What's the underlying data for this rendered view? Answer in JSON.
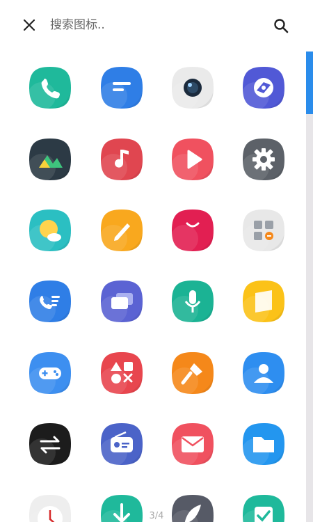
{
  "header": {
    "close_icon": "close-icon",
    "search_placeholder": "搜索图标..",
    "search_icon": "search-icon"
  },
  "icons": [
    {
      "name": "phone-icon",
      "color": "#1fb99b"
    },
    {
      "name": "messages-icon",
      "color": "#2f7ee6"
    },
    {
      "name": "camera-icon",
      "color": "#eaeaea"
    },
    {
      "name": "browser-icon",
      "color": "#5159d6"
    },
    {
      "name": "gallery-icon",
      "color": "#2c3a45"
    },
    {
      "name": "music-icon",
      "color": "#e04650"
    },
    {
      "name": "video-icon",
      "color": "#f0515f"
    },
    {
      "name": "settings-icon",
      "color": "#5c6168"
    },
    {
      "name": "weather-icon",
      "color": "#2bbfc2"
    },
    {
      "name": "notes-icon",
      "color": "#f9a81e"
    },
    {
      "name": "store-icon",
      "color": "#e21f52"
    },
    {
      "name": "tools-folder-icon",
      "color": "#e8e8e8"
    },
    {
      "name": "contacts-phone-icon",
      "color": "#2f7ee6"
    },
    {
      "name": "multitask-icon",
      "color": "#5b63d3"
    },
    {
      "name": "recorder-icon",
      "color": "#1bb394"
    },
    {
      "name": "files-yellow-icon",
      "color": "#fbc218"
    },
    {
      "name": "game-center-icon",
      "color": "#3d8ff0"
    },
    {
      "name": "theme-shapes-icon",
      "color": "#e8464e"
    },
    {
      "name": "paint-brush-icon",
      "color": "#f5881a"
    },
    {
      "name": "contacts-icon",
      "color": "#2e8ef0"
    },
    {
      "name": "data-transfer-icon",
      "color": "#1c1c1c"
    },
    {
      "name": "radio-icon",
      "color": "#4b63c8"
    },
    {
      "name": "email-icon",
      "color": "#f0515f"
    },
    {
      "name": "file-manager-icon",
      "color": "#2396ef"
    },
    {
      "name": "clock-icon",
      "color": "#eeeeee"
    },
    {
      "name": "download-icon",
      "color": "#1fb99b"
    },
    {
      "name": "feather-icon",
      "color": "#565a66"
    },
    {
      "name": "task-check-icon",
      "color": "#1fb99b"
    }
  ],
  "page_indicator": "3/4",
  "scrollbar": {
    "thumb_position": 0.0
  }
}
